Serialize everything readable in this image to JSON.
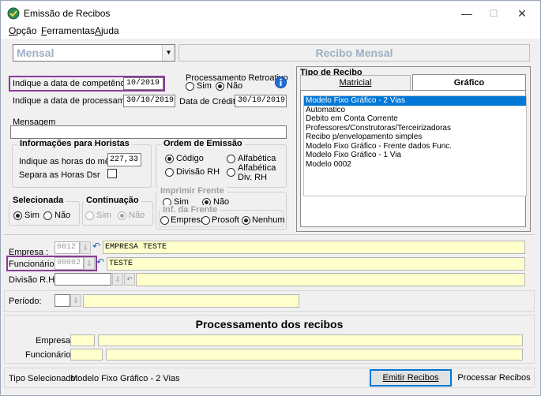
{
  "window": {
    "title": "Emissão de Recibos",
    "minimize": "—",
    "maximize": "☐",
    "close": "✕"
  },
  "menu": [
    {
      "pre": "",
      "key": "O",
      "post": "pção"
    },
    {
      "pre": "",
      "key": "F",
      "post": "erramentas"
    },
    {
      "pre": "",
      "key": "A",
      "post": "juda"
    }
  ],
  "tipo_select": {
    "value": "Mensal"
  },
  "banner": "Recibo Mensal",
  "competencia": {
    "label": "Indique a data de competência",
    "value": "10/2019"
  },
  "processamento": {
    "label": "Indique a data de processamento",
    "value": "30/10/2019"
  },
  "credito": {
    "label": "Data de Crédito",
    "value": "30/10/2019"
  },
  "retroativo": {
    "title": "Processamento Retroativo",
    "sim": "Sim",
    "nao": "Não",
    "selected": "Não"
  },
  "mensagem": {
    "label": "Mensagem",
    "value": ""
  },
  "horistas": {
    "title": "Informações para Horistas",
    "horas_label": "Indique as horas do mês",
    "horas_value": "227,33",
    "dsr_label": "Separa as Horas Dsr"
  },
  "ordem": {
    "title": "Ordem de Emissão",
    "codigo": "Código",
    "alfabetica": "Alfabética",
    "divisao": "Divisão RH",
    "alfa_div_1": "Alfabética",
    "alfa_div_2": "Div.  RH",
    "selected": "Código"
  },
  "selecionada": {
    "title": "Selecionada",
    "sim": "Sim",
    "nao": "Não",
    "selected": "Sim"
  },
  "continuacao": {
    "title": "Continuação",
    "sim": "Sim",
    "nao": "Não",
    "selected": "Não"
  },
  "imprimir_frente": {
    "title": "Imprimir Frente",
    "sim": "Sim",
    "nao": "Não",
    "selected": "Não"
  },
  "inf_frente": {
    "title": "Inf. da Frente",
    "empresa": "Empresa",
    "prosoft": "Prosoft",
    "nenhum": "Nenhum",
    "selected": "Nenhum"
  },
  "tipo_recibo": {
    "title": "Tipo de Recibo",
    "tabs": [
      "Matricial",
      "Gráfico"
    ],
    "active_tab": "Gráfico",
    "items": [
      "Modelo Fixo Gráfico - 2 Vias",
      "Automatico",
      "Debito em Conta Corrente",
      "Professores/Construtoras/Terceirizadoras",
      "Recibo p/envelopamento simples",
      "Modelo Fixo Gráfico - Frente dados Func.",
      "Modelo Fixo Gráfico - 1 Via",
      "Modelo 0002"
    ],
    "selected_index": 0
  },
  "empresa": {
    "label": "Empresa :",
    "code": "0012",
    "name": "EMPRESA TESTE"
  },
  "funcionario": {
    "label": "Funcionário :",
    "code": "00002",
    "name": "TESTE"
  },
  "divisao": {
    "label": "Divisão R.H.:",
    "code": "",
    "name": ""
  },
  "periodo": {
    "label": "Período:",
    "code": "",
    "name": ""
  },
  "processamento_recibos": {
    "title": "Processamento dos recibos",
    "empresa_label": "Empresa:",
    "funcionario_label": "Funcionário:"
  },
  "status": {
    "label": "Tipo Selecionado:",
    "value": "Modelo Fixo Gráfico - 2 Vias"
  },
  "buttons": {
    "emitir": "Emitir Recibos",
    "processar": "Processar Recibos"
  },
  "colors": {
    "highlight": "#8a3a9a",
    "selection": "#0078d7",
    "banner_text": "#9fb0c4",
    "yellow_field": "#ffffcc"
  }
}
